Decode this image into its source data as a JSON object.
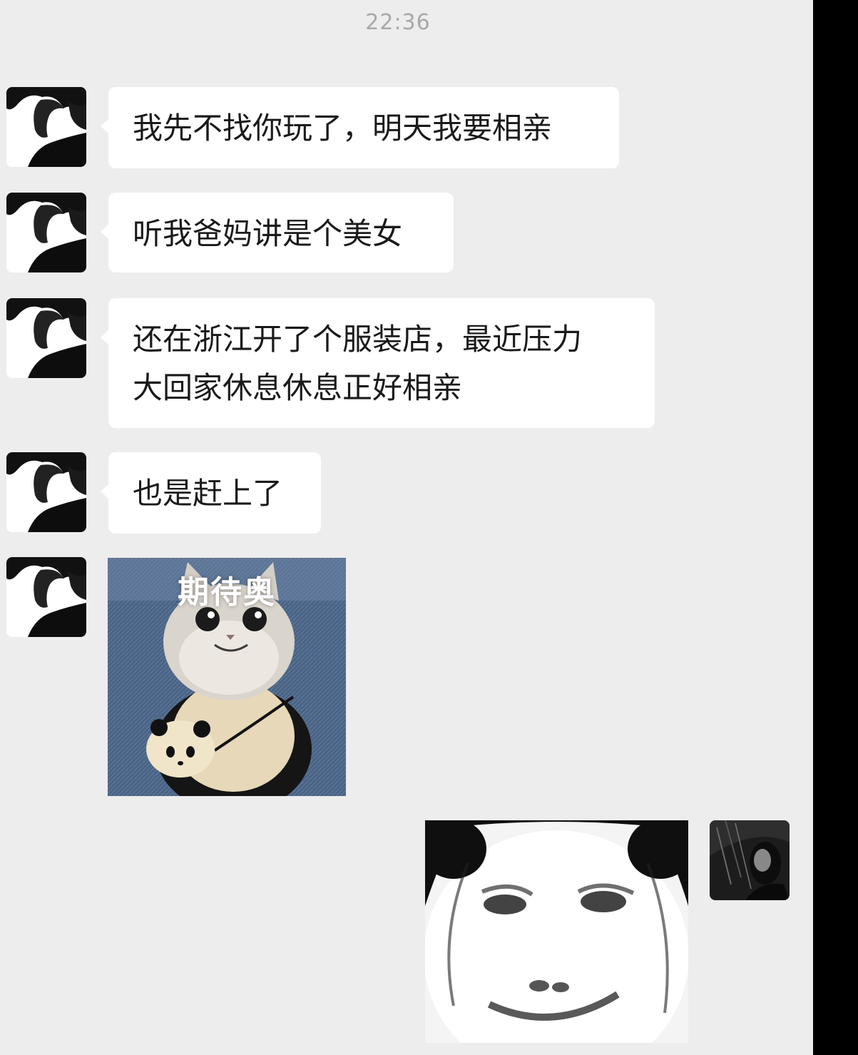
{
  "chat": {
    "timestamp": "22:36",
    "messages": [
      {
        "sender": "contact",
        "type": "text",
        "text": "我先不找你玩了，明天我要相亲"
      },
      {
        "sender": "contact",
        "type": "text",
        "text": "听我爸妈讲是个美女"
      },
      {
        "sender": "contact",
        "type": "text",
        "lines": [
          "还在浙江开了个服装店，最近压力",
          "大回家休息休息正好相亲"
        ]
      },
      {
        "sender": "contact",
        "type": "text",
        "text": "也是赶上了"
      },
      {
        "sender": "contact",
        "type": "sticker",
        "caption": "期待奥",
        "icon": "cat-in-panda-costume-sticker"
      },
      {
        "sender": "self",
        "type": "sticker",
        "icon": "panda-face-meme-sticker"
      }
    ]
  },
  "colors": {
    "background": "#ededed",
    "bubble": "#ffffff",
    "text": "#1a1a1a",
    "timestamp": "#a8a8a8"
  }
}
